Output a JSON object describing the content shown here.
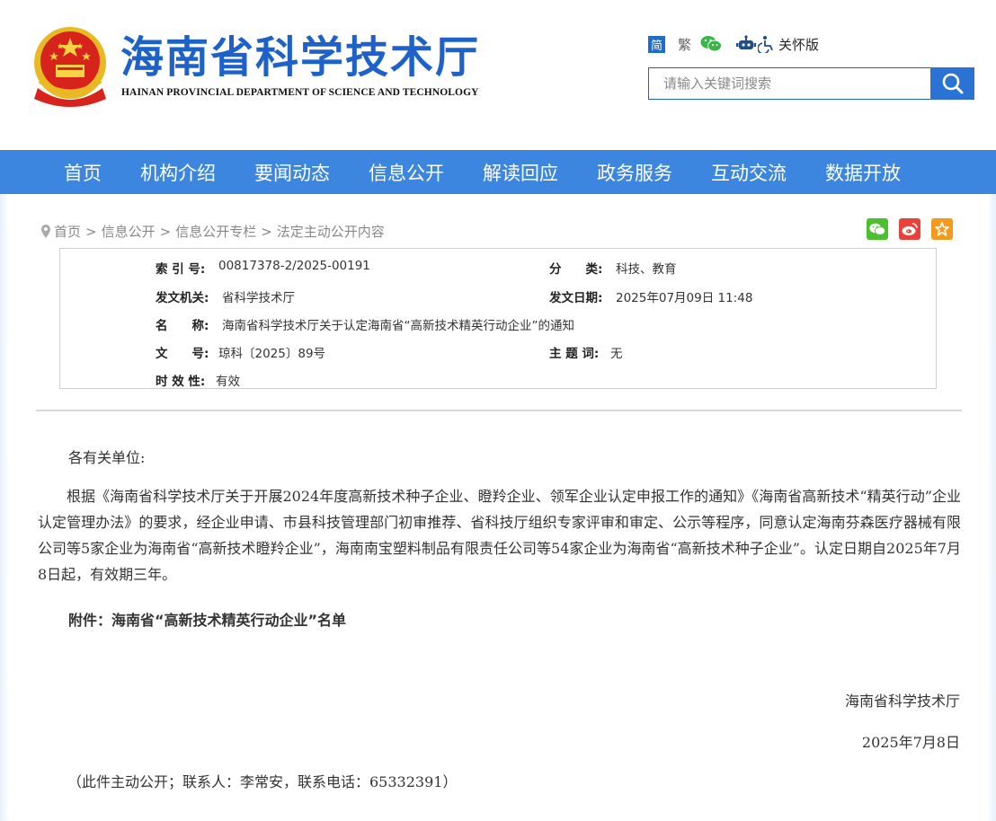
{
  "header": {
    "title": "海南省科学技术厅",
    "subtitle": "HAINAN PROVINCIAL DEPARTMENT OF SCIENCE AND TECHNOLOGY",
    "tools": {
      "simplified": "简",
      "traditional": "繁",
      "care_mode": "关怀版"
    },
    "search": {
      "placeholder": "请输入关键词搜索"
    }
  },
  "nav": {
    "items": [
      "首页",
      "机构介绍",
      "要闻动态",
      "信息公开",
      "解读回应",
      "政务服务",
      "互动交流",
      "数据开放"
    ]
  },
  "breadcrumb": {
    "items": [
      "首页",
      "信息公开",
      "信息公开专栏",
      "法定主动公开内容"
    ],
    "separator": ">"
  },
  "meta": {
    "index_label": "索 引 号:",
    "index_value": "00817378-2/2025-00191",
    "category_label": "分　　类:",
    "category_value": "科技、教育",
    "issuer_label": "发文机关:",
    "issuer_value": "省科学技术厅",
    "date_label": "发文日期:",
    "date_value": "2025年07月09日 11:48",
    "name_label": "名　　称:",
    "name_value": "海南省科学技术厅关于认定海南省“高新技术精英行动企业”的通知",
    "docno_label": "文　　号:",
    "docno_value": "琼科〔2025〕89号",
    "keywords_label": "主 题 词:",
    "keywords_value": "无",
    "validity_label": "时 效 性:",
    "validity_value": "有效"
  },
  "article": {
    "salutation": "各有关单位:",
    "body": "根据《海南省科学技术厅关于开展2024年度高新技术种子企业、瞪羚企业、领军企业认定申报工作的通知》《海南省高新技术“精英行动”企业认定管理办法》的要求，经企业申请、市县科技管理部门初审推荐、省科技厅组织专家评审和审定、公示等程序，同意认定海南芬森医疗器械有限公司等5家企业为海南省“高新技术瞪羚企业”，海南南宝塑料制品有限责任公司等54家企业为海南省“高新技术种子企业”。认定日期自2025年7月8日起，有效期三年。",
    "attachment": "附件：海南省“高新技术精英行动企业”名单",
    "signer": "海南省科学技术厅",
    "sign_date": "2025年7月8日",
    "contact": "（此件主动公开；联系人：李常安，联系电话：65332391）"
  },
  "colors": {
    "brand_blue": "#1e62c9",
    "nav_blue": "#3c86e0",
    "wechat_green": "#4bbf2e",
    "weibo_red": "#e8423a",
    "favorite_orange": "#f39a1c"
  }
}
